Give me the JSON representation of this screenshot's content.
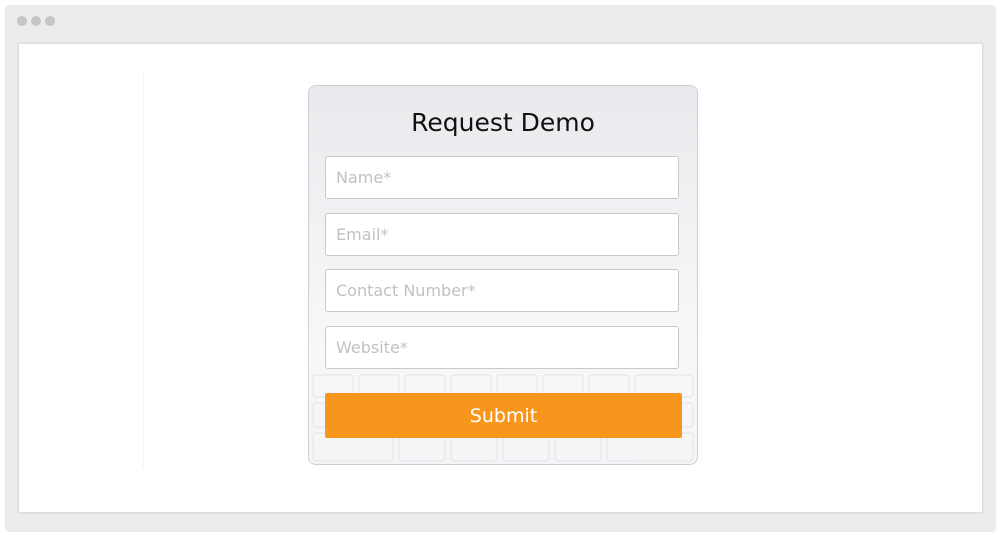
{
  "window": {
    "dot_colors": [
      "#c6c6c6",
      "#c6c6c6",
      "#c6c6c6"
    ]
  },
  "form": {
    "title": "Request Demo",
    "fields": [
      {
        "placeholder": "Name*",
        "value": ""
      },
      {
        "placeholder": "Email*",
        "value": ""
      },
      {
        "placeholder": "Contact Number*",
        "value": ""
      },
      {
        "placeholder": "Website*",
        "value": ""
      }
    ],
    "submit_label": "Submit"
  },
  "colors": {
    "accent": "#f7961d",
    "window_frame": "#ececec",
    "card_border": "#cfcfd3"
  }
}
